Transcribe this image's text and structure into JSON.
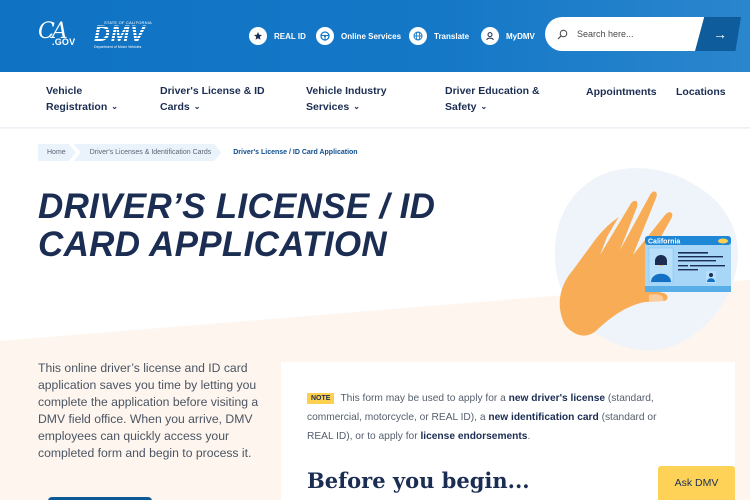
{
  "header": {
    "ca_logo": {
      "main": "CA",
      "sub": ".GOV"
    },
    "dmv_logo": {
      "state": "STATE OF CALIFORNIA",
      "name": "DMV",
      "department": "Department of Motor Vehicles"
    },
    "utility_links": [
      {
        "label": "REAL ID",
        "icon": "star-icon"
      },
      {
        "label": "Online Services",
        "icon": "steering-wheel-icon"
      },
      {
        "label": "Translate",
        "icon": "globe-icon"
      },
      {
        "label": "MyDMV",
        "icon": "user-icon"
      }
    ],
    "search": {
      "placeholder": "Search here...",
      "submit_icon": "arrow-right-icon",
      "submit_glyph": "→"
    }
  },
  "nav": {
    "items": [
      {
        "label_line1": "Vehicle",
        "label_line2": "Registration",
        "has_dropdown": true
      },
      {
        "label_line1": "Driver's License & ID",
        "label_line2": "Cards",
        "has_dropdown": true
      },
      {
        "label_line1": "Vehicle Industry",
        "label_line2": "Services",
        "has_dropdown": true
      },
      {
        "label_line1": "Driver Education &",
        "label_line2": "Safety",
        "has_dropdown": true
      },
      {
        "label_line1": "Appointments",
        "has_dropdown": false
      },
      {
        "label_line1": "Locations",
        "has_dropdown": false
      }
    ],
    "chevron": "⌄"
  },
  "breadcrumb": [
    {
      "label": "Home"
    },
    {
      "label": "Driver's Licenses & Identification Cards"
    },
    {
      "label": "Driver's License / ID Card Application",
      "current": true
    }
  ],
  "hero": {
    "title_line1": "Driver’s License / ID",
    "title_line2": "Card Application",
    "illustration": {
      "card_state": "California"
    }
  },
  "intro": {
    "text": "This online driver’s license and ID card application saves you time by letting you complete the application before visiting a DMV field office. When you arrive, DMV employees can quickly access your completed form and begin to process it."
  },
  "note_card": {
    "tag": "NOTE",
    "segments": [
      {
        "text": "This form may be used to apply for a ",
        "bold": false
      },
      {
        "text": "new driver's license",
        "bold": true
      },
      {
        "text": " (standard, commercial, motorcycle, or REAL ID), a ",
        "bold": false
      },
      {
        "text": "new identification card",
        "bold": true
      },
      {
        "text": " (standard or REAL ID), or to apply for ",
        "bold": false
      },
      {
        "text": "license endorsements",
        "bold": true
      },
      {
        "text": ".",
        "bold": false
      }
    ],
    "heading": "Before you begin..."
  },
  "ask_dmv": {
    "label": "Ask DMV"
  },
  "colors": {
    "header_blue": "#1578c7",
    "navy": "#1b2d52",
    "search_button": "#0e5c9c",
    "accent_yellow": "#fdd257",
    "cream": "#fdf5ee",
    "skin": "#f8ac55",
    "card_blue": "#a8d6f7"
  }
}
